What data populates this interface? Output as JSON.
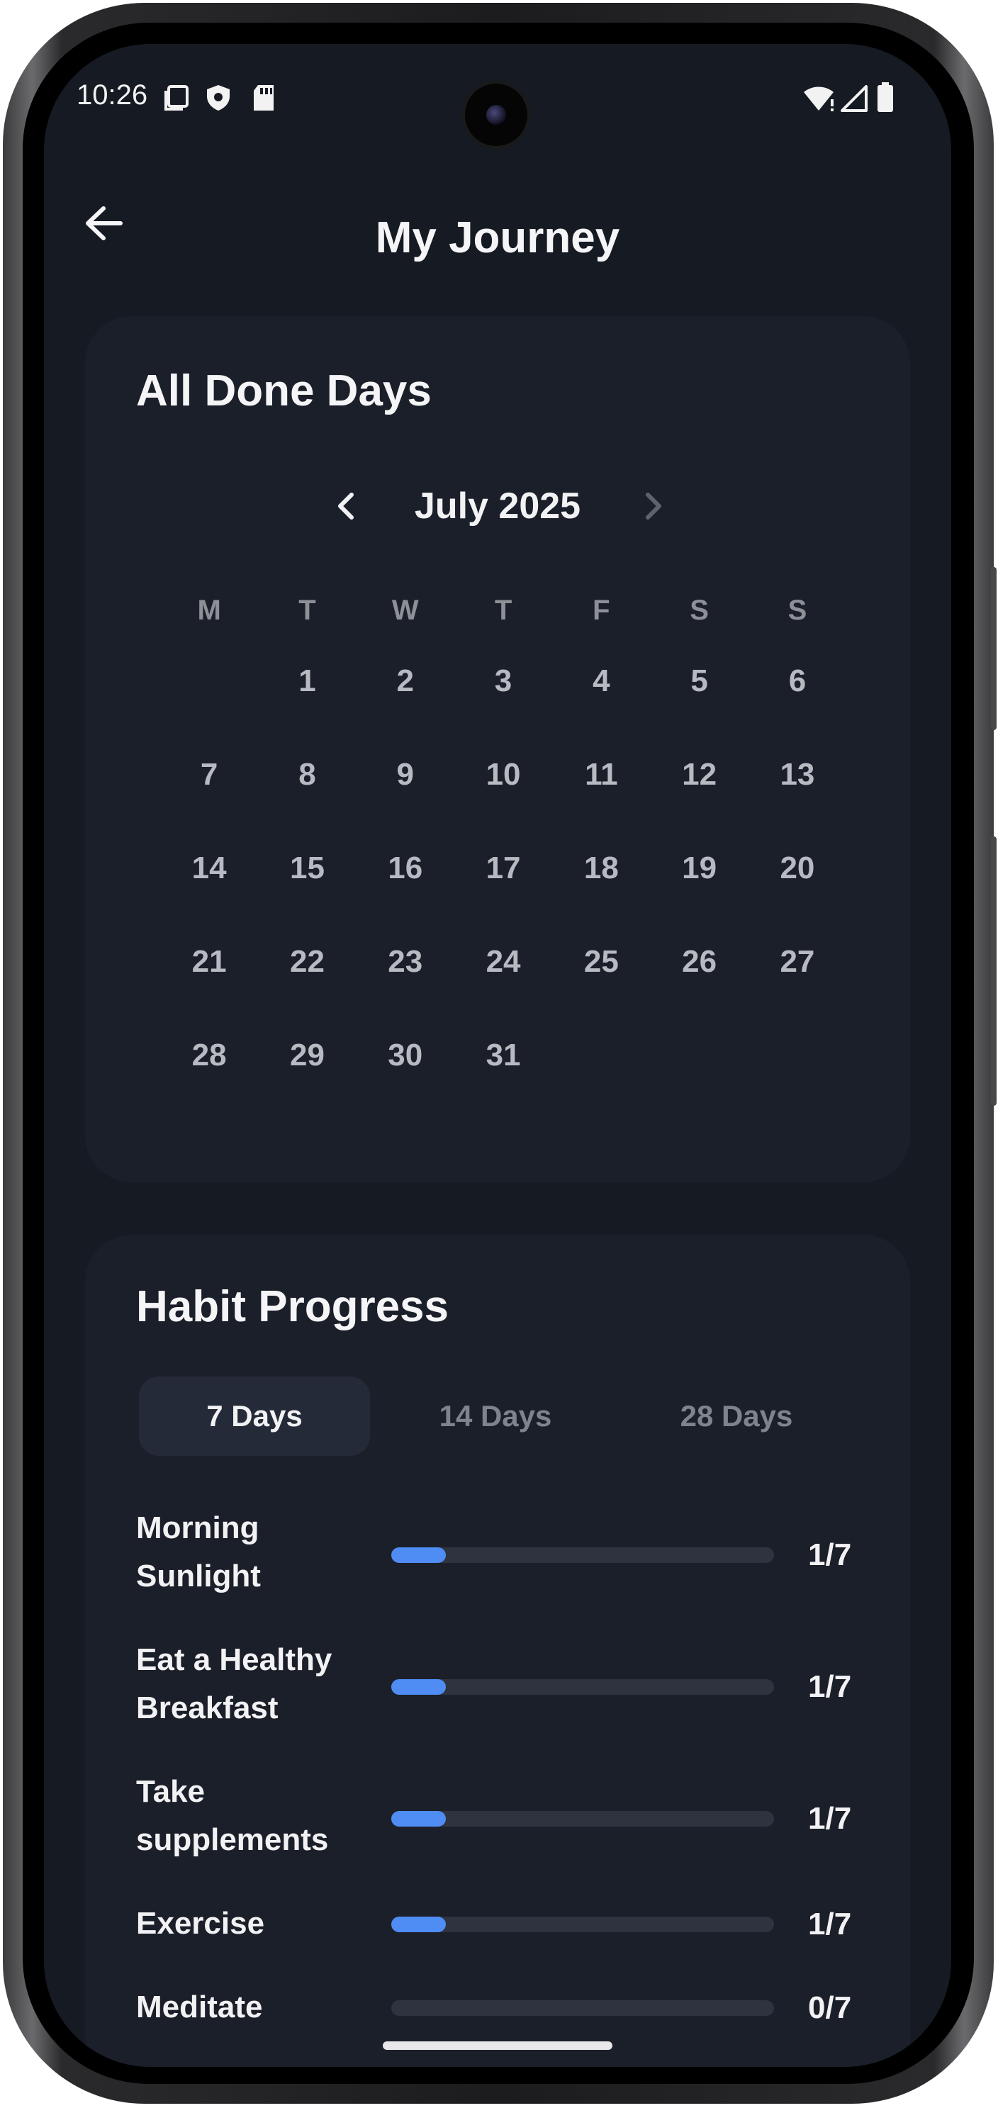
{
  "status_bar": {
    "time": "10:26",
    "left_icons": [
      "screenshot-icon",
      "shield-icon",
      "sd-card-icon"
    ],
    "right_icons": [
      "wifi-icon",
      "signal-icon",
      "battery-icon"
    ]
  },
  "header": {
    "title": "My Journey",
    "back_icon": "arrow-left-icon"
  },
  "calendar_card": {
    "title": "All Done Days",
    "month_label": "July 2025",
    "weekdays": [
      "M",
      "T",
      "W",
      "T",
      "F",
      "S",
      "S"
    ],
    "leading_blank_days": 1,
    "days": [
      "1",
      "2",
      "3",
      "4",
      "5",
      "6",
      "7",
      "8",
      "9",
      "10",
      "11",
      "12",
      "13",
      "14",
      "15",
      "16",
      "17",
      "18",
      "19",
      "20",
      "21",
      "22",
      "23",
      "24",
      "25",
      "26",
      "27",
      "28",
      "29",
      "30",
      "31"
    ]
  },
  "progress_card": {
    "title": "Habit Progress",
    "tabs": [
      {
        "label": "7 Days",
        "active": true
      },
      {
        "label": "14 Days",
        "active": false
      },
      {
        "label": "28 Days",
        "active": false
      }
    ],
    "habits": [
      {
        "name": "Morning Sunlight",
        "count": "1/7",
        "fraction": 0.143
      },
      {
        "name": "Eat a Healthy Breakfast",
        "count": "1/7",
        "fraction": 0.143
      },
      {
        "name": "Take supplements",
        "count": "1/7",
        "fraction": 0.143
      },
      {
        "name": "Exercise",
        "count": "1/7",
        "fraction": 0.143
      },
      {
        "name": "Meditate",
        "count": "0/7",
        "fraction": 0
      }
    ]
  },
  "colors": {
    "background": "#161a22",
    "card": "#1b1f29",
    "accent": "#4f8cf3",
    "track": "#2e333f"
  }
}
